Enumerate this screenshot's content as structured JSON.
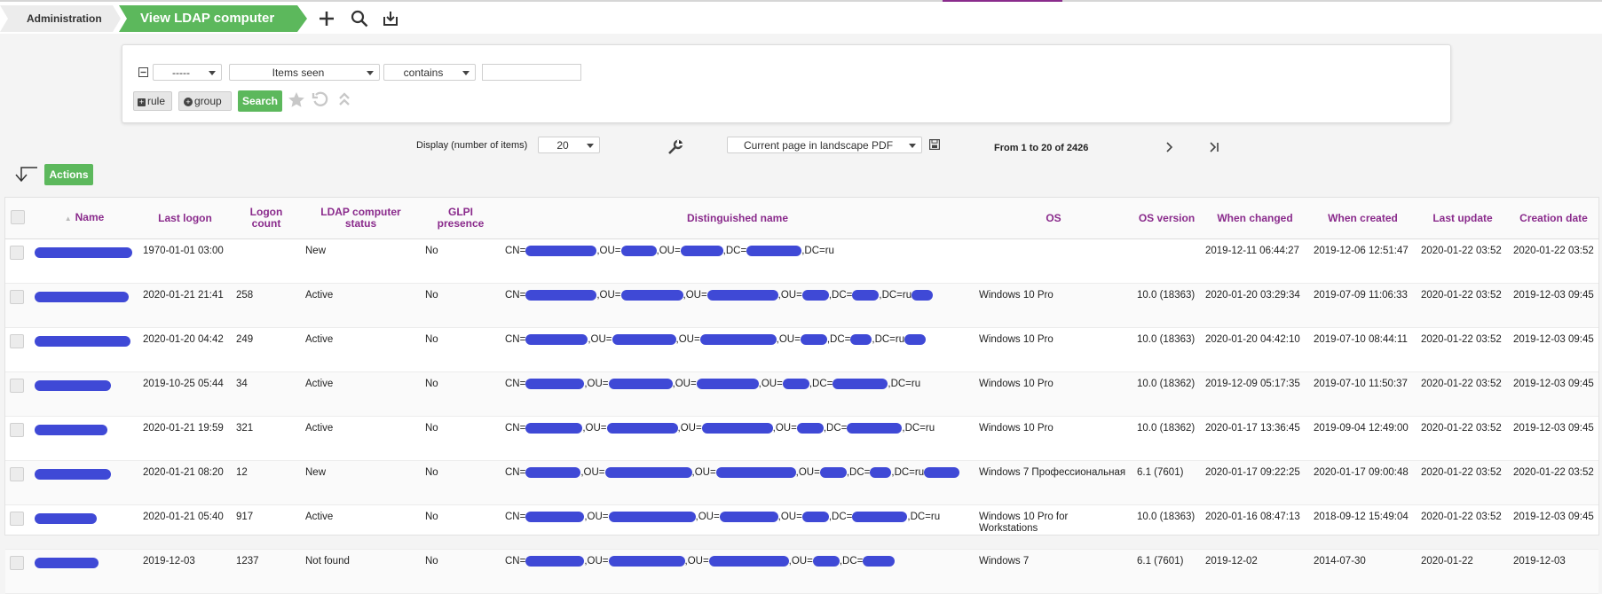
{
  "breadcrumb": {
    "root": "Administration",
    "current": "View LDAP computer"
  },
  "header_icons": [
    "plus-icon",
    "search-icon",
    "download-icon"
  ],
  "search": {
    "field_select": "-----",
    "criterion_select": "Items seen",
    "operator_select": "contains",
    "value": "",
    "rule_label": "rule",
    "group_label": "group",
    "search_label": "Search"
  },
  "pager": {
    "display_label": "Display (number of items)",
    "page_size": "20",
    "export_option": "Current page in landscape PDF",
    "range_text": "From 1 to 20 of 2426"
  },
  "actions_label": "Actions",
  "colors": {
    "accent": "#5cb85c",
    "header_text": "#8a2b8c",
    "redaction": "#3f49d6"
  },
  "table": {
    "columns": [
      "Name",
      "Last logon",
      "Logon count",
      "LDAP computer status",
      "GLPI presence",
      "Distinguished name",
      "OS",
      "OS version",
      "When changed",
      "When created",
      "Last update",
      "Creation date"
    ],
    "rows": [
      {
        "last_logon": "1970-01-01 03:00",
        "logon_count": "",
        "status": "New",
        "presence": "No",
        "dn": [
          "CN=",
          ",OU=",
          ",OU=",
          ",DC=",
          ",DC=ru"
        ],
        "os": "",
        "os_version": "",
        "when_changed": "2019-12-11 06:44:27",
        "when_created": "2019-12-06 12:51:47",
        "last_update": "2020-01-22 03:52",
        "creation_date": "2020-01-22 03:52"
      },
      {
        "last_logon": "2020-01-21 21:41",
        "logon_count": "258",
        "status": "Active",
        "presence": "No",
        "dn": [
          "CN=",
          ",OU=",
          ",OU=",
          ",OU=",
          ",DC=",
          ",DC=ru"
        ],
        "os": "Windows 10 Pro",
        "os_version": "10.0 (18363)",
        "when_changed": "2020-01-20 03:29:34",
        "when_created": "2019-07-09 11:06:33",
        "last_update": "2020-01-22 03:52",
        "creation_date": "2019-12-03 09:45"
      },
      {
        "last_logon": "2020-01-20 04:42",
        "logon_count": "249",
        "status": "Active",
        "presence": "No",
        "dn": [
          "CN=",
          ",OU=",
          ",OU=",
          ",OU=",
          ",DC=",
          ",DC=ru"
        ],
        "os": "Windows 10 Pro",
        "os_version": "10.0 (18363)",
        "when_changed": "2020-01-20 04:42:10",
        "when_created": "2019-07-10 08:44:11",
        "last_update": "2020-01-22 03:52",
        "creation_date": "2019-12-03 09:45"
      },
      {
        "last_logon": "2019-10-25 05:44",
        "logon_count": "34",
        "status": "Active",
        "presence": "No",
        "dn": [
          "CN=",
          ",OU=",
          ",OU=",
          ",OU=",
          ",DC=",
          ",DC=ru"
        ],
        "os": "Windows 10 Pro",
        "os_version": "10.0 (18362)",
        "when_changed": "2019-12-09 05:17:35",
        "when_created": "2019-07-10 11:50:37",
        "last_update": "2020-01-22 03:52",
        "creation_date": "2019-12-03 09:45"
      },
      {
        "last_logon": "2020-01-21 19:59",
        "logon_count": "321",
        "status": "Active",
        "presence": "No",
        "dn": [
          "CN=",
          ",OU=",
          ",OU=",
          ",OU=",
          ",DC=",
          ",DC=ru"
        ],
        "os": "Windows 10 Pro",
        "os_version": "10.0 (18362)",
        "when_changed": "2020-01-17 13:36:45",
        "when_created": "2019-09-04 12:49:00",
        "last_update": "2020-01-22 03:52",
        "creation_date": "2019-12-03 09:45"
      },
      {
        "last_logon": "2020-01-21 08:20",
        "logon_count": "12",
        "status": "New",
        "presence": "No",
        "dn": [
          "CN=",
          ",OU=",
          ",OU=",
          ",OU=",
          ",DC=",
          ",DC=ru"
        ],
        "os": "Windows 7 Профессиональная",
        "os_version": "6.1 (7601)",
        "when_changed": "2020-01-17 09:22:25",
        "when_created": "2020-01-17 09:00:48",
        "last_update": "2020-01-22 03:52",
        "creation_date": "2020-01-22 03:52"
      },
      {
        "last_logon": "2020-01-21 05:40",
        "logon_count": "917",
        "status": "Active",
        "presence": "No",
        "dn": [
          "CN=",
          ",OU=",
          ",OU=",
          ",OU=",
          ",DC=",
          ",DC=ru"
        ],
        "os": "Windows 10 Pro for Workstations",
        "os_version": "10.0 (18363)",
        "when_changed": "2020-01-16 08:47:13",
        "when_created": "2018-09-12 15:49:04",
        "last_update": "2020-01-22 03:52",
        "creation_date": "2019-12-03 09:45"
      },
      {
        "last_logon": "2019-12-03",
        "logon_count": "1237",
        "status": "Not found",
        "presence": "No",
        "dn": [
          "CN=",
          ",OU=",
          ",OU=",
          ",OU=",
          ",DC="
        ],
        "os": "Windows 7",
        "os_version": "6.1 (7601)",
        "when_changed": "2019-12-02",
        "when_created": "2014-07-30",
        "last_update": "2020-01-22",
        "creation_date": "2019-12-03"
      }
    ]
  }
}
